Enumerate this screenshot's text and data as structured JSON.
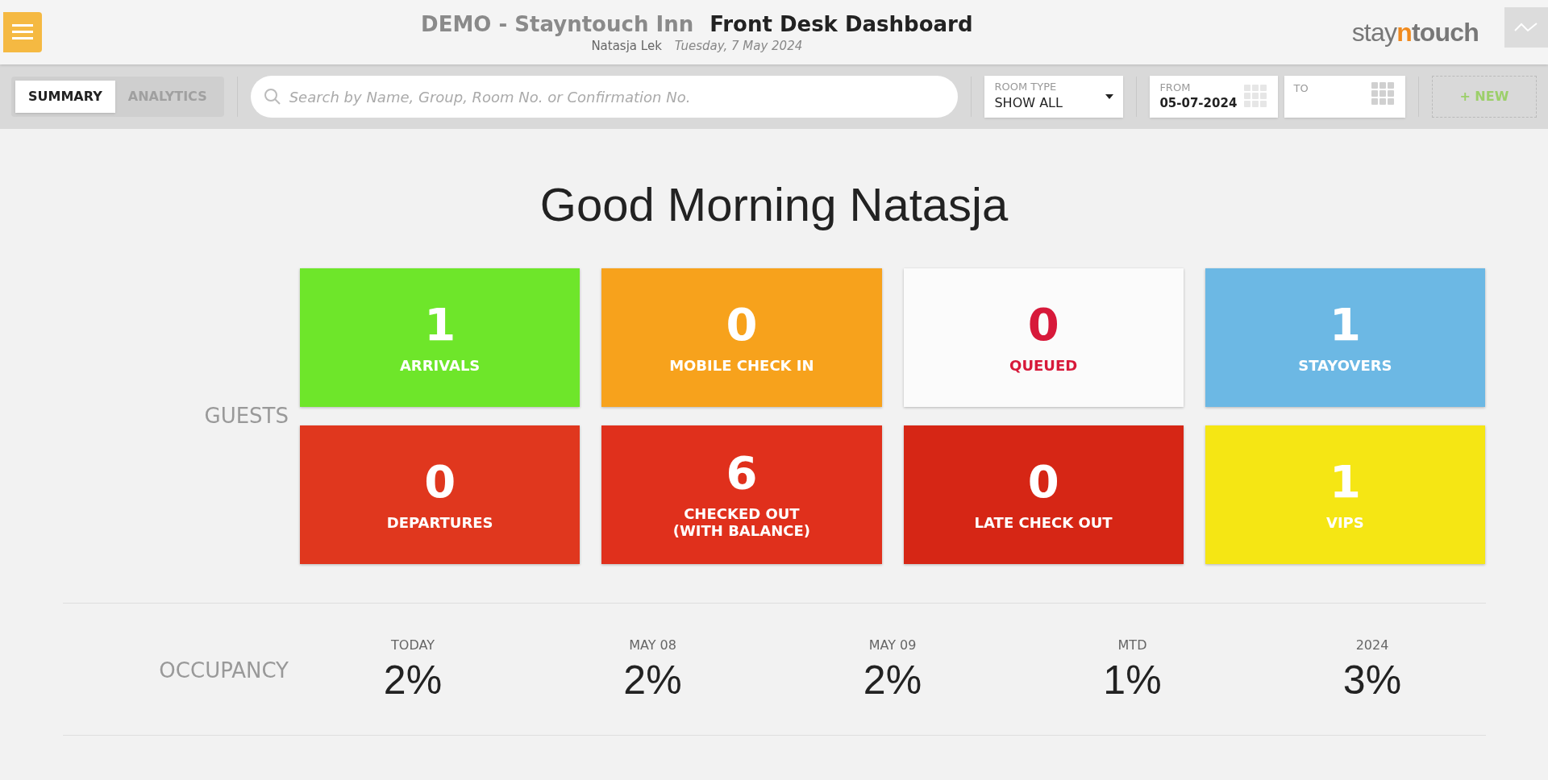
{
  "header": {
    "hotel": "DEMO - Stayntouch Inn",
    "title": "Front Desk Dashboard",
    "user": "Natasja Lek",
    "date": "Tuesday, 7 May 2024",
    "logo_left": "stay",
    "logo_mid": "n",
    "logo_right": "touch"
  },
  "tabs": [
    {
      "label": "SUMMARY",
      "selected": true
    },
    {
      "label": "ANALYTICS",
      "selected": false
    }
  ],
  "search": {
    "placeholder": "Search by Name, Group, Room No. or Confirmation No."
  },
  "room_type": {
    "label": "ROOM TYPE",
    "value": "SHOW ALL"
  },
  "from": {
    "label": "FROM",
    "value": "05-07-2024"
  },
  "to": {
    "label": "TO"
  },
  "new_button": "+ NEW",
  "greeting": "Good Morning Natasja",
  "guests": {
    "label": "GUESTS",
    "tiles": [
      {
        "count": "1",
        "label": "ARRIVALS",
        "kind": "filled",
        "color": "#6ee62a"
      },
      {
        "count": "0",
        "label": "MOBILE CHECK IN",
        "kind": "filled",
        "color": "#f7a21c"
      },
      {
        "count": "0",
        "label": "QUEUED",
        "kind": "plain",
        "color": "#d7193a"
      },
      {
        "count": "1",
        "label": "STAYOVERS",
        "kind": "filled",
        "color": "#6cb8e4"
      },
      {
        "count": "0",
        "label": "DEPARTURES",
        "kind": "filled",
        "color": "#e0371e"
      },
      {
        "count": "6",
        "label": "CHECKED OUT\n(WITH BALANCE)",
        "kind": "filled",
        "color": "#e0301c"
      },
      {
        "count": "0",
        "label": "LATE CHECK OUT",
        "kind": "filled",
        "color": "#d62615"
      },
      {
        "count": "1",
        "label": "VIPS",
        "kind": "filled",
        "color": "#f5e614"
      }
    ]
  },
  "occupancy": {
    "label": "OCCUPANCY",
    "columns": [
      {
        "heading": "TODAY",
        "value": "2%"
      },
      {
        "heading": "MAY 08",
        "value": "2%"
      },
      {
        "heading": "MAY 09",
        "value": "2%"
      },
      {
        "heading": "MTD",
        "value": "1%"
      },
      {
        "heading": "2024",
        "value": "3%"
      }
    ]
  }
}
